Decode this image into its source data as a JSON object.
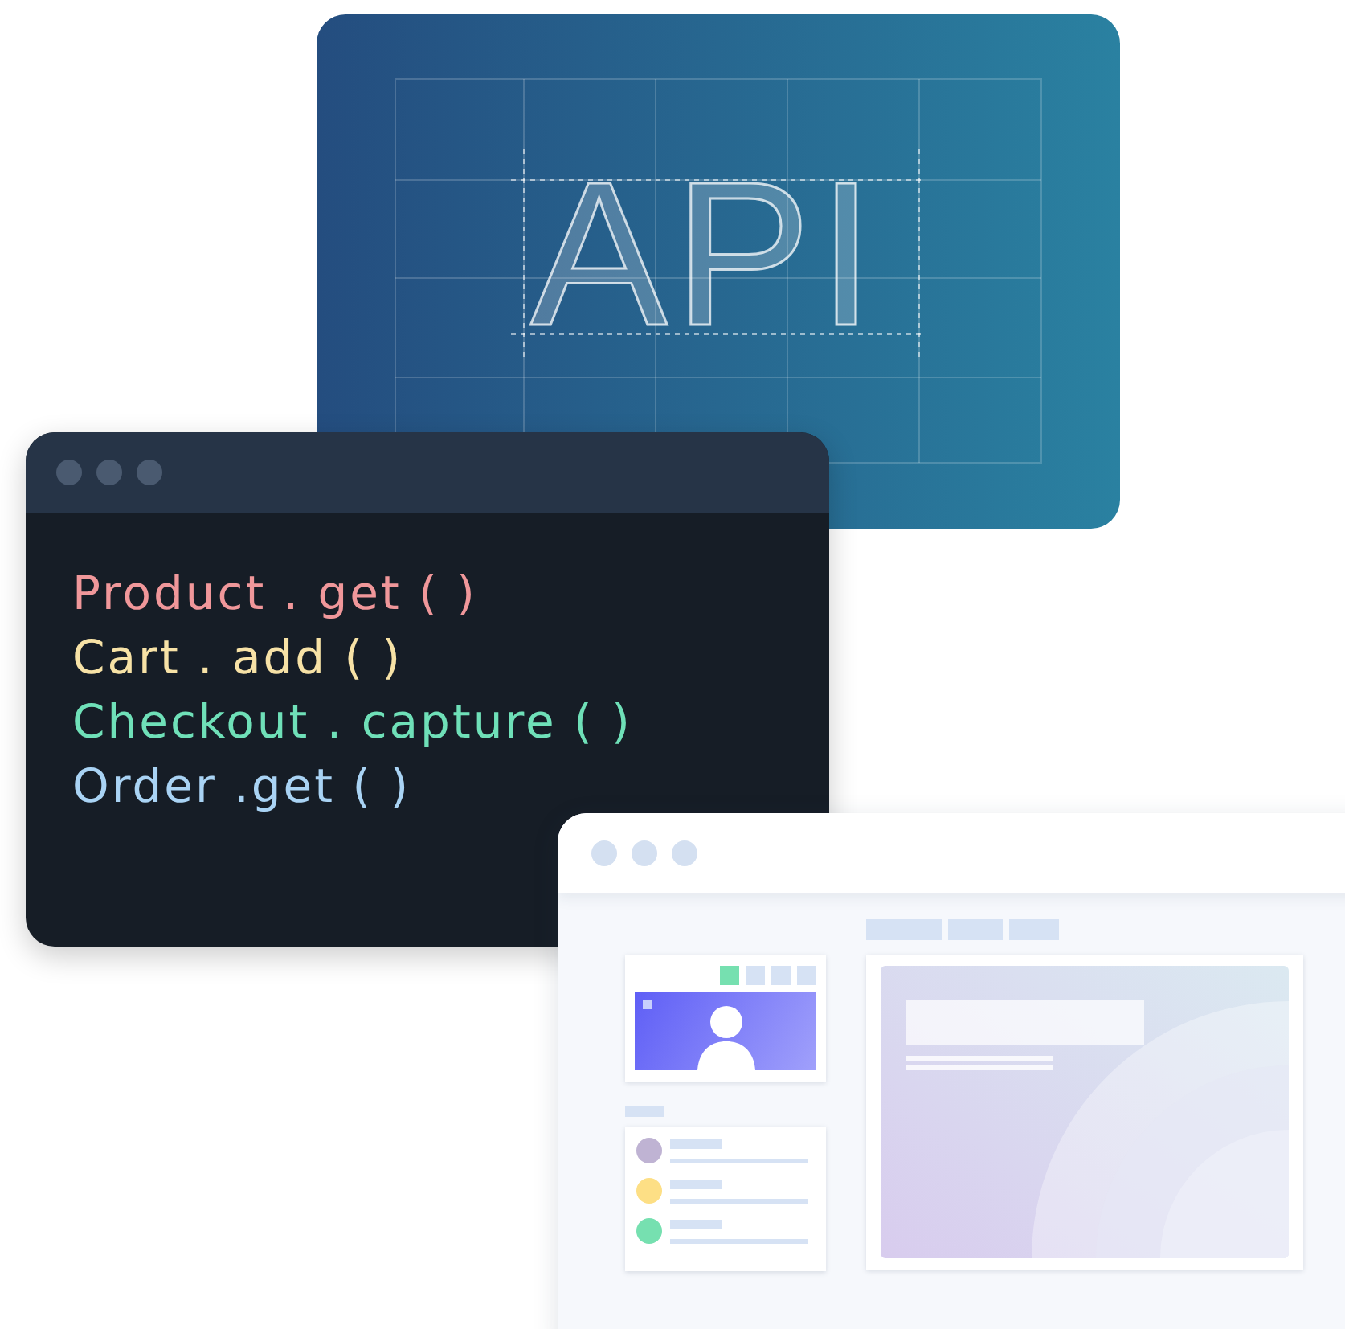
{
  "api_card": {
    "title": "API"
  },
  "code_window": {
    "lines": [
      {
        "text": "Product . get ( )",
        "color": "#f0979a"
      },
      {
        "text": "Cart . add ( )",
        "color": "#f7e2a6"
      },
      {
        "text": "Checkout . capture ( )",
        "color": "#6fe0b8"
      },
      {
        "text": "Order .get ( )",
        "color": "#a9d3f4"
      }
    ]
  },
  "browser_window": {
    "toolbar_squares": [
      {
        "selected": true
      },
      {
        "selected": false
      },
      {
        "selected": false
      },
      {
        "selected": false
      }
    ],
    "contacts": [
      {
        "color": "#bfb3d3"
      },
      {
        "color": "#fddf85"
      },
      {
        "color": "#76e0b0"
      }
    ]
  }
}
